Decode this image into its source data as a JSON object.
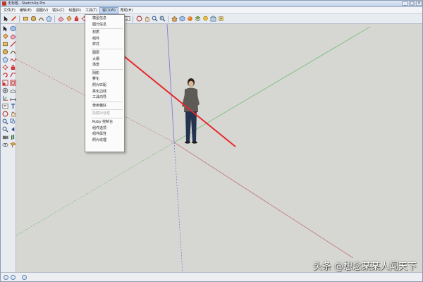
{
  "window": {
    "title": "无标题 - SketchUp Pro",
    "controls": [
      "_",
      "□",
      "×"
    ]
  },
  "menubar": {
    "items": [
      "文件(F)",
      "编辑(E)",
      "视图(V)",
      "镜头(C)",
      "绘图(R)",
      "工具(T)",
      "窗口(W)",
      "帮助(H)"
    ],
    "active_index": 6
  },
  "toolbar": {
    "icons": [
      "arrow-select-icon",
      "pencil-icon",
      "rectangle-icon",
      "circle-icon",
      "arc-icon",
      "eraser-icon",
      "paint-bucket-icon",
      "push-pull-icon",
      "move-icon",
      "rotate-icon",
      "tape-measure-icon",
      "orbit-icon",
      "pan-icon",
      "zoom-icon",
      "zoom-extents-icon",
      "house-icon",
      "component-icon",
      "materials-icon",
      "layers-icon",
      "shadows-icon",
      "warehouse-icon",
      "extension-icon",
      "section-icon"
    ]
  },
  "window_menu": {
    "items": [
      {
        "label": "模型信息",
        "enabled": true
      },
      {
        "label": "图元信息",
        "enabled": true
      },
      {
        "sep": true
      },
      {
        "label": "材质",
        "enabled": true
      },
      {
        "label": "组件",
        "enabled": true
      },
      {
        "label": "样式",
        "enabled": true
      },
      {
        "sep": true
      },
      {
        "label": "图层",
        "enabled": true
      },
      {
        "label": "大纲",
        "enabled": true
      },
      {
        "label": "场景",
        "enabled": true
      },
      {
        "sep": true
      },
      {
        "label": "阴影",
        "enabled": true
      },
      {
        "label": "雾化",
        "enabled": true
      },
      {
        "label": "照片匹配",
        "enabled": true
      },
      {
        "label": "柔化边线",
        "enabled": true
      },
      {
        "label": "工具向导",
        "enabled": true
      },
      {
        "sep": true
      },
      {
        "label": "使用偏好",
        "enabled": true
      },
      {
        "sep": true
      },
      {
        "label": "隐藏对话框",
        "enabled": false
      },
      {
        "sep": true
      },
      {
        "label": "Ruby 控制台",
        "enabled": true
      },
      {
        "label": "组件选项",
        "enabled": true
      },
      {
        "label": "组件属性",
        "enabled": true
      },
      {
        "label": "照片纹理",
        "enabled": true
      }
    ]
  },
  "watermark": "头条 @想念某某人闯天下",
  "colors": {
    "axis_red": "#c47a86",
    "axis_green": "#7dbf84",
    "axis_blue": "#7f7fd6",
    "annotation_arrow": "#e8262c",
    "menu_highlight": "#c5d9f1"
  }
}
